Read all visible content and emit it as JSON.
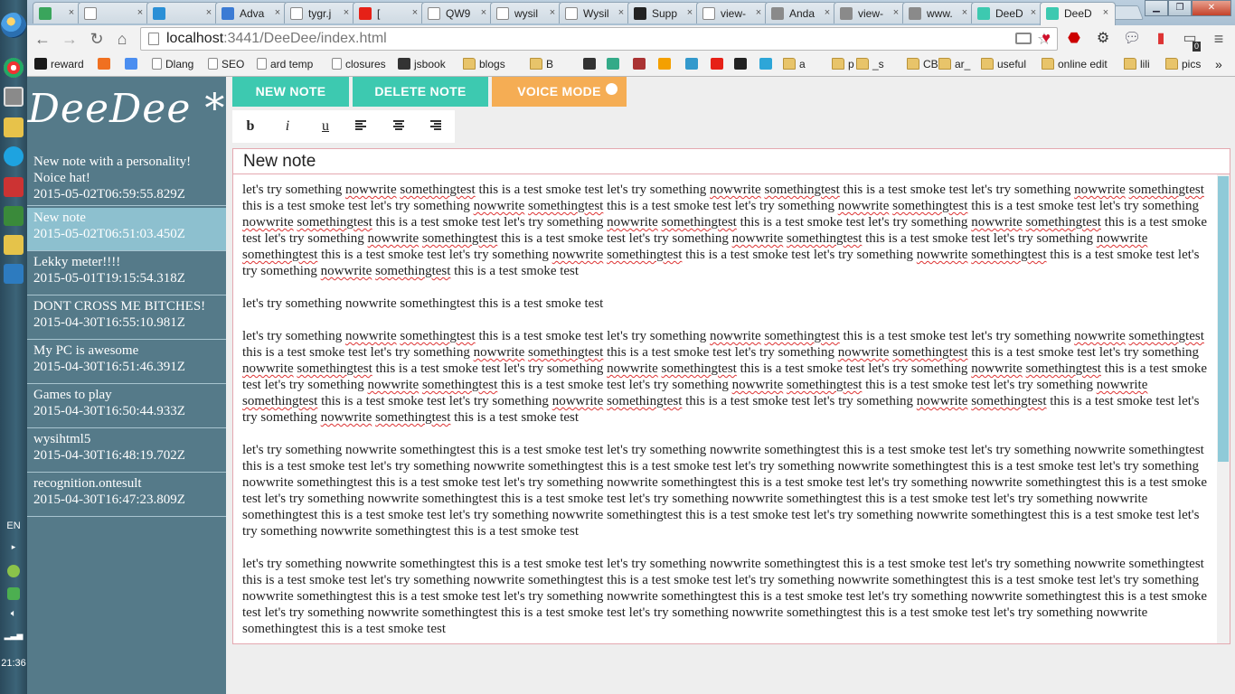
{
  "taskbar": {
    "lang": "EN",
    "clock": "21:36"
  },
  "browser": {
    "tabs": [
      {
        "title": "",
        "icon": "pear-icon"
      },
      {
        "title": "",
        "icon": "page-icon"
      },
      {
        "title": "",
        "icon": "compass-icon"
      },
      {
        "title": "Adva",
        "icon": "house-icon"
      },
      {
        "title": "tygr.j",
        "icon": "page-icon"
      },
      {
        "title": "[",
        "icon": "youtube-icon"
      },
      {
        "title": "QW9",
        "icon": "page-icon"
      },
      {
        "title": "wysil",
        "icon": "page-icon"
      },
      {
        "title": "Wysil",
        "icon": "page-icon"
      },
      {
        "title": "Supp",
        "icon": "github-icon"
      },
      {
        "title": "view-",
        "icon": "page-icon"
      },
      {
        "title": "Anda",
        "icon": "btu-icon"
      },
      {
        "title": "view-",
        "icon": "btu-icon"
      },
      {
        "title": "www.",
        "icon": "btu-icon"
      },
      {
        "title": "DeeD",
        "icon": "deedee-icon"
      },
      {
        "title": "DeeD",
        "icon": "deedee-icon"
      }
    ],
    "address": {
      "host": "localhost",
      "path": ":3441/DeeDee/index.html"
    },
    "extension_badge": "0",
    "bookmarks": [
      {
        "label": "reward",
        "icon": "k-icon"
      },
      {
        "label": "",
        "icon": "bookmark-icon"
      },
      {
        "label": "",
        "icon": "translate-icon"
      },
      {
        "label": "Dlang",
        "icon": "page-icon"
      },
      {
        "label": "SEO",
        "icon": "page-icon"
      },
      {
        "label": "ard temp",
        "icon": "page-icon"
      },
      {
        "label": "closures",
        "icon": "page-icon"
      },
      {
        "label": "jsbook",
        "icon": "book-icon"
      },
      {
        "label": "blogs",
        "icon": "folder-icon"
      },
      {
        "label": "B",
        "icon": "folder-icon"
      },
      {
        "label": "a",
        "icon": "folder-icon"
      },
      {
        "label": "p",
        "icon": "folder-icon"
      },
      {
        "label": "_s",
        "icon": "folder-icon"
      },
      {
        "label": "CB",
        "icon": "folder-icon"
      },
      {
        "label": "ar_",
        "icon": "folder-icon"
      },
      {
        "label": "useful",
        "icon": "folder-icon"
      },
      {
        "label": "online edit",
        "icon": "folder-icon"
      },
      {
        "label": "lili",
        "icon": "folder-icon"
      },
      {
        "label": "pics",
        "icon": "folder-icon"
      }
    ],
    "more_bookmarks": "»"
  },
  "app": {
    "logo": "DeeDee *",
    "buttons": {
      "new_note": "NEW NOTE",
      "delete_note": "DELETE NOTE",
      "voice_mode": "VOICE MODE"
    },
    "format": {
      "bold": "b",
      "italic": "i",
      "underline": "u"
    },
    "notes": [
      {
        "title": "New note with a personality! Noice hat!",
        "date": "2015-05-02T06:59:55.829Z"
      },
      {
        "title": "New note",
        "date": "2015-05-02T06:51:03.450Z"
      },
      {
        "title": "Lekky meter!!!!",
        "date": "2015-05-01T19:15:54.318Z"
      },
      {
        "title": "DONT CROSS ME BITCHES!",
        "date": "2015-04-30T16:55:10.981Z"
      },
      {
        "title": "My PC is awesome",
        "date": "2015-04-30T16:51:46.391Z"
      },
      {
        "title": "Games to play",
        "date": "2015-04-30T16:50:44.933Z"
      },
      {
        "title": "wysihtml5",
        "date": "2015-04-30T16:48:19.702Z"
      },
      {
        "title": "recognition.ontesult",
        "date": "2015-04-30T16:47:23.809Z"
      }
    ],
    "editor": {
      "title": "New note",
      "paragraph_a": "let's try something nowwrite somethingtest this is a test smoke test  let's try something nowwrite somethingtest this is a test smoke test let's try something nowwrite somethingtest this is a test smoke test let's try something nowwrite somethingtest this is a test smoke test let's try something nowwrite somethingtest this is a test smoke test let's try something nowwrite somethingtest this is a test smoke test let's try something nowwrite somethingtest this is a test smoke test let's try something nowwrite somethingtest this is a test smoke test let's try something nowwrite somethingtest this is a test smoke test let's try something nowwrite somethingtest this is a test smoke test let's try something nowwrite somethingtest this is a test smoke test let's try something nowwrite somethingtest this is a test smoke test let's try something nowwrite somethingtest this is a test smoke test let's try something nowwrite somethingtest this is a test smoke test",
      "paragraph_b": "let's try something nowwrite somethingtest this is a test smoke test",
      "paragraph_c": "let's try something nowwrite somethingtest this is a test smoke test let's try something nowwrite somethingtest this is a test smoke test let's try something nowwrite somethingtest this is a test smoke test let's try something nowwrite somethingtest this is a test smoke test let's try something nowwrite somethingtest this is a test smoke test let's try something nowwrite somethingtest this is a test smoke test let's try something nowwrite somethingtest this is a test smoke test let's try something nowwrite somethingtest this is a test smoke test let's try something nowwrite somethingtest this is a test smoke test let's try something nowwrite somethingtest this is a test smoke test let's try something nowwrite somethingtest this is a test smoke test let's try something nowwrite somethingtest this is a test smoke test let's try something nowwrite somethingtest this is a test smoke test let's try something nowwrite somethingtest this is a test smoke test",
      "paragraph_d": "let's try something nowwrite somethingtest this is a test smoke test let's try something nowwrite somethingtest this is a test smoke test let's try something nowwrite somethingtest this is a test smoke test let's try something nowwrite somethingtest this is a test smoke test let's try something nowwrite somethingtest this is a test smoke test let's try something nowwrite somethingtest this is a test smoke test let's try something nowwrite somethingtest this is a test smoke test let's try something nowwrite somethingtest this is a test smoke test let's try something nowwrite somethingtest this is a test smoke test let's try something nowwrite somethingtest this is a test smoke test let's try something nowwrite somethingtest this is a test smoke test let's try something nowwrite somethingtest this is a test smoke test let's try something nowwrite somethingtest this is a test smoke test let's try something nowwrite somethingtest this is a test smoke test",
      "paragraph_e": "let's try something nowwrite somethingtest this is a test smoke test let's try something nowwrite somethingtest this is a test smoke test let's try something nowwrite somethingtest this is a test smoke test let's try something nowwrite somethingtest this is a test smoke test let's try something nowwrite somethingtest this is a test smoke test let's try something nowwrite somethingtest this is a test smoke test let's try something nowwrite somethingtest this is a test smoke test let's try something nowwrite somethingtest this is a test smoke test let's try something nowwrite somethingtest this is a test smoke test let's try something nowwrite somethingtest this is a test smoke test let's try something nowwrite somethingtest this is a test smoke test"
    }
  },
  "colors": {
    "sidebar": "#557a89",
    "sidebar_selected": "#8dc0cf",
    "teal_button": "#3dc9b0",
    "orange_button": "#f5ad54",
    "editor_border": "#e4a8b0"
  }
}
